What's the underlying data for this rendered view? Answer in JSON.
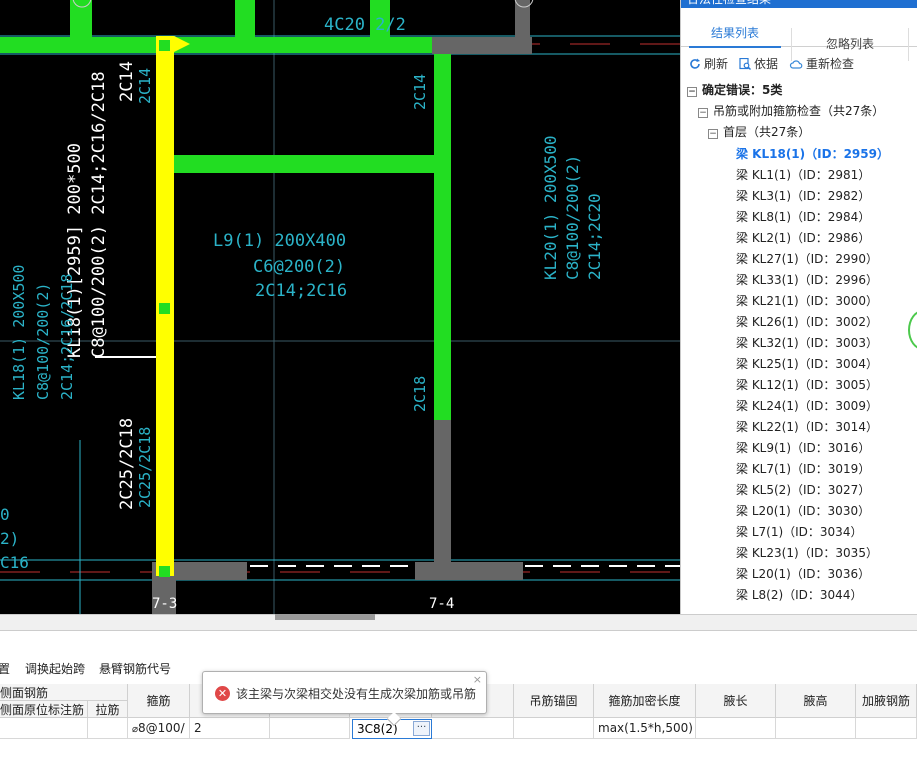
{
  "panel": {
    "title": "合法性检查结果",
    "tabs": [
      "结果列表",
      "忽略列表"
    ],
    "toolbar": {
      "refresh": "刷新",
      "basis": "依据",
      "recheck": "重新检查"
    },
    "tree": {
      "root": "确定错误：5类",
      "group": "吊筋或附加箍筋检查（共27条）",
      "floor": "首层（共27条）",
      "items": [
        "梁 KL18(1)（ID：2959）",
        "梁 KL1(1)（ID：2981）",
        "梁 KL3(1)（ID：2982）",
        "梁 KL8(1)（ID：2984）",
        "梁 KL2(1)（ID：2986）",
        "梁 KL27(1)（ID：2990）",
        "梁 KL33(1)（ID：2996）",
        "梁 KL21(1)（ID：3000）",
        "梁 KL26(1)（ID：3002）",
        "梁 KL32(1)（ID：3003）",
        "梁 KL25(1)（ID：3004）",
        "梁 KL12(1)（ID：3005）",
        "梁 KL24(1)（ID：3009）",
        "梁 KL22(1)（ID：3014）",
        "梁 KL9(1)（ID：3016）",
        "梁 KL7(1)（ID：3019）",
        "梁 KL5(2)（ID：3027）",
        "梁 L20(1)（ID：3030）",
        "梁 L7(1)（ID：3034）",
        "梁 KL23(1)（ID：3035）",
        "梁 L20(1)（ID：3036）",
        "梁 L8(2)（ID：3044）"
      ]
    }
  },
  "cad": {
    "top_label": "4C20 2/2",
    "kl18_line1": "KL18(1)[2959] 200*500",
    "kl18_line2": "C8@100/200(2) 2C14;2C16/2C18",
    "kl18_top": "2C14",
    "kl18_top_cyan": "2C14",
    "kl18_bottom": "2C25/2C18",
    "kl18_bottom_cyan": "2C25/2C18",
    "l9_line1": "L9(1) 200X400",
    "l9_line2": "C6@200(2)",
    "l9_line3": "2C14;2C16",
    "kl20_line1": "KL20(1) 200X500",
    "kl20_line2": "C8@100/200(2)",
    "kl20_line3": "2C14;2C20",
    "mid_2c14": "2C14",
    "mid_2c18": "2C18",
    "left_line1": "KL18(1) 200X500",
    "left_line2": "C8@100/200(2)",
    "left_line3": "2C14;2C16/2C18",
    "left_frag1": "0",
    "left_frag2": "2)",
    "left_frag3": "C16",
    "axis_a": "7-3",
    "axis_b": "7-4"
  },
  "bottom_toolbar": [
    "置",
    "调换起始跨",
    "悬臂钢筋代号"
  ],
  "table": {
    "headers": {
      "side_bar": "侧面钢筋",
      "side_note": "侧面原位标注筋",
      "tie": "拉筋",
      "stirrup": "箍筋",
      "hanger_anchor": "吊筋锚固",
      "dense_len": "箍筋加密长度",
      "haunch_len": "腋长",
      "haunch_h": "腋高",
      "haunch_bar": "加腋钢筋"
    },
    "row": {
      "stirrup": "8@100/",
      "legs": "2",
      "extra": "3C8(2)",
      "dense_len": "max(1.5*h,500)"
    }
  },
  "tooltip": {
    "message": "该主梁与次梁相交处没有生成次梁加筋或吊筋",
    "close": "×"
  }
}
